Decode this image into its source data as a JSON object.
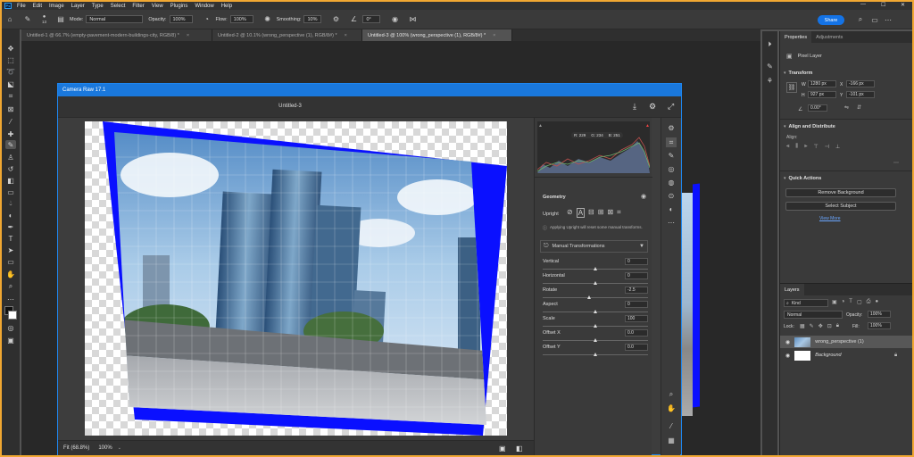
{
  "menubar": {
    "logo": "Ps",
    "items": [
      "File",
      "Edit",
      "Image",
      "Layer",
      "Type",
      "Select",
      "Filter",
      "View",
      "Plugins",
      "Window",
      "Help"
    ],
    "window_controls": [
      "—",
      "☐",
      "✕"
    ]
  },
  "options_bar": {
    "brush_size": "13",
    "mode_label": "Mode:",
    "mode_value": "Normal",
    "opacity_label": "Opacity:",
    "opacity_value": "100%",
    "flow_label": "Flow:",
    "flow_value": "100%",
    "smoothing_label": "Smoothing:",
    "smoothing_value": "10%",
    "angle_value": "0°",
    "share_label": "Share"
  },
  "doc_tabs": [
    {
      "label": "Untitled-1 @ 66.7% (empty-pavement-modern-buildings-city, RGB/8) *",
      "active": false
    },
    {
      "label": "Untitled-2 @ 10.1% (wrong_perspective (1), RGB/8#) *",
      "active": false
    },
    {
      "label": "Untitled-3 @ 100% (wrong_perspective (1), RGB/8#) *",
      "active": true
    }
  ],
  "tab_close": "×",
  "camera_raw": {
    "title": "Camera Raw 17.1",
    "doc_title": "Untitled-3",
    "histogram_readout": {
      "r": "R: 229",
      "g": "G: 234",
      "b": "B: 251"
    },
    "geometry": {
      "heading": "Geometry",
      "upright_label": "Upright",
      "upright_note": "Applying Upright will reset some manual transforms.",
      "manual_label": "Manual Transformations",
      "sliders": [
        {
          "label": "Vertical",
          "value": "0",
          "pos": 0.5
        },
        {
          "label": "Horizontal",
          "value": "0",
          "pos": 0.5
        },
        {
          "label": "Rotate",
          "value": "-2.5",
          "pos": 0.44
        },
        {
          "label": "Aspect",
          "value": "0",
          "pos": 0.5
        },
        {
          "label": "Scale",
          "value": "100",
          "pos": 0.5
        },
        {
          "label": "Offset X",
          "value": "0.0",
          "pos": 0.5
        },
        {
          "label": "Offset Y",
          "value": "0.0",
          "pos": 0.5
        }
      ]
    },
    "footer": {
      "fit_label": "Fit (68.8%)",
      "zoom_value": "100%"
    }
  },
  "properties": {
    "tabs": [
      "Properties",
      "Adjustments"
    ],
    "layer_type": "Pixel Layer",
    "transform_heading": "Transform",
    "w_label": "W",
    "w_value": "1280 px",
    "h_label": "H",
    "h_value": "927 px",
    "x_label": "X",
    "x_value": "-166 px",
    "y_label": "Y",
    "y_value": "-101 px",
    "angle_value": "0.00°",
    "align_heading": "Align and Distribute",
    "align_label": "Align:",
    "quick_heading": "Quick Actions",
    "remove_bg": "Remove Background",
    "select_subject": "Select Subject",
    "view_more": "View More"
  },
  "layers": {
    "tab": "Layers",
    "filter_label": "Kind",
    "blend_mode": "Normal",
    "opacity_label": "Opacity:",
    "opacity_value": "100%",
    "lock_label": "Lock:",
    "fill_label": "Fill:",
    "fill_value": "100%",
    "items": [
      {
        "name": "wrong_perspective (1)",
        "selected": true
      },
      {
        "name": "Background",
        "selected": false
      }
    ]
  },
  "colors": {
    "accent": "#1473e6",
    "title_bar": "#1a78dc",
    "frame": "#f0a732",
    "transform_fill": "#0a10ff"
  }
}
